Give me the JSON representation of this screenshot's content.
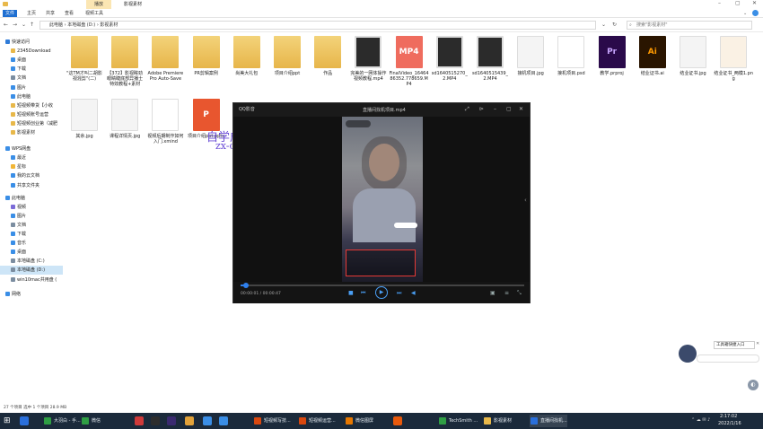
{
  "window": {
    "title": "影视素材",
    "play_tab": "播放"
  },
  "ribbon": {
    "tabs": [
      "文件",
      "主页",
      "共享",
      "查看",
      "视频工具"
    ]
  },
  "address": {
    "path": [
      "此电脑",
      "本地磁盘 (D:)",
      "影视素材"
    ],
    "search_placeholder": "搜索\"影视素材\""
  },
  "nav_pane": {
    "items": [
      {
        "label": "快速访问",
        "icon": "star-icon",
        "color": "#2f7bd8"
      },
      {
        "label": "2345Download",
        "icon": "folder-icon",
        "color": "#e8b84a"
      },
      {
        "label": "桌面",
        "icon": "desktop-icon",
        "color": "#3a8ee6"
      },
      {
        "label": "下载",
        "icon": "download-icon",
        "color": "#3a8ee6"
      },
      {
        "label": "文档",
        "icon": "document-icon",
        "color": "#7b8da0"
      },
      {
        "label": "图片",
        "icon": "picture-icon",
        "color": "#3a8ee6"
      },
      {
        "label": "此电脑",
        "icon": "computer-icon",
        "color": "#3a8ee6"
      },
      {
        "label": "短视频带货【小收",
        "icon": "folder-icon",
        "color": "#e8b84a"
      },
      {
        "label": "短视频账号运营",
        "icon": "folder-icon",
        "color": "#e8b84a"
      },
      {
        "label": "短视频创业第（减肥",
        "icon": "folder-icon",
        "color": "#e8b84a"
      },
      {
        "label": "影视素材",
        "icon": "folder-icon",
        "color": "#e8b84a"
      },
      {
        "label": "WPS网盘",
        "icon": "cloud-icon",
        "color": "#3a8ee6"
      },
      {
        "label": "最近",
        "icon": "clock-icon",
        "color": "#3a8ee6"
      },
      {
        "label": "星标",
        "icon": "star-icon",
        "color": "#f2b636"
      },
      {
        "label": "我的云文档",
        "icon": "cloud-icon",
        "color": "#3a8ee6"
      },
      {
        "label": "共享文件夹",
        "icon": "share-folder-icon",
        "color": "#3a8ee6"
      },
      {
        "label": "此电脑",
        "icon": "computer-icon",
        "color": "#3a8ee6"
      },
      {
        "label": "视频",
        "icon": "video-icon",
        "color": "#7b6bd8"
      },
      {
        "label": "图片",
        "icon": "picture-icon",
        "color": "#3a8ee6"
      },
      {
        "label": "文档",
        "icon": "document-icon",
        "color": "#7b8da0"
      },
      {
        "label": "下载",
        "icon": "download-icon",
        "color": "#3a8ee6"
      },
      {
        "label": "音乐",
        "icon": "music-icon",
        "color": "#3a8ee6"
      },
      {
        "label": "桌面",
        "icon": "desktop-icon",
        "color": "#3a8ee6"
      },
      {
        "label": "本地磁盘 (C:)",
        "icon": "drive-icon",
        "color": "#7b8da0"
      },
      {
        "label": "本地磁盘 (D:)",
        "icon": "drive-icon",
        "color": "#7b8da0"
      },
      {
        "label": "win10mac共用盘 (",
        "icon": "drive-icon",
        "color": "#7b8da0"
      },
      {
        "label": "网络",
        "icon": "network-icon",
        "color": "#3a8ee6"
      }
    ]
  },
  "files": {
    "row1": [
      {
        "name": "\"这TM才叫二胡影视混剪\"(二)",
        "kind": "folder"
      },
      {
        "name": "【372】影视眸劲眼睛睫底部异播士特效教程+素材",
        "kind": "folder"
      },
      {
        "name": "Adobe Premiere Pro Auto-Save",
        "kind": "folder"
      },
      {
        "name": "PR剪辑案例",
        "kind": "folder"
      },
      {
        "name": "尚美大礼包",
        "kind": "folder"
      },
      {
        "name": "项目介绍ppt",
        "kind": "folder"
      },
      {
        "name": "作品",
        "kind": "folder"
      },
      {
        "name": "完美的一网体操作视频教程.mp4",
        "kind": "video"
      },
      {
        "name": "FinalVideo_1646486352.778659.MP4",
        "kind": "mp4"
      },
      {
        "name": "sd1640515270_2.MP4",
        "kind": "video"
      },
      {
        "name": "sd1640515439_2.MP4",
        "kind": "video"
      },
      {
        "name": "接机项目.jpg",
        "kind": "jpg"
      },
      {
        "name": "接机项目.psd",
        "kind": "psd"
      },
      {
        "name": "教学.prproj",
        "kind": "prproj"
      },
      {
        "name": "结业证书.ai",
        "kind": "ai"
      },
      {
        "name": "结业证书.jpg",
        "kind": "jpg"
      },
      {
        "name": "结业证书_两模1.png",
        "kind": "png"
      }
    ],
    "row2": [
      {
        "name": "其余.jpg",
        "kind": "jpg"
      },
      {
        "name": "课程详情页.jpg",
        "kind": "jpg"
      },
      {
        "name": "视频后期制作如何入门.xmind",
        "kind": "xmind"
      },
      {
        "name": "项目介绍ppt.pptx",
        "kind": "pptx"
      }
    ]
  },
  "watermark": {
    "line1": "自学成才网",
    "line2": "zx-cc.net"
  },
  "player": {
    "app_name": "QQ影音",
    "file_title": "直播间找机项目.mp4",
    "time_current": "00:00:01",
    "time_total": "00:00:47",
    "progress": 0.02
  },
  "float_widget": {
    "label": "工具箱快捷入口"
  },
  "status": {
    "text": "27 个项目   选中 1 个项目  28.9 MB"
  },
  "taskbar": {
    "apps": [
      {
        "label": "",
        "color": "#2a6fdb"
      },
      {
        "label": "大羽白 - 手...",
        "color": "#2f9e44"
      },
      {
        "label": "微信",
        "color": "#2f9e44"
      },
      {
        "label": "",
        "color": "#cf3a3a"
      },
      {
        "label": "",
        "color": "#2d2d2d"
      },
      {
        "label": "",
        "color": "#3a2a70"
      },
      {
        "label": "",
        "color": "#e2a23a"
      },
      {
        "label": "",
        "color": "#3a8ee6"
      },
      {
        "label": "",
        "color": "#3a8ee6"
      },
      {
        "label": "短视频写技...",
        "color": "#d9480f"
      },
      {
        "label": "短视频运营...",
        "color": "#d9480f"
      },
      {
        "label": "微信图屏",
        "color": "#e67700"
      },
      {
        "label": "",
        "color": "#e8590c"
      },
      {
        "label": "TechSmith ...",
        "color": "#2f9e44"
      },
      {
        "label": "影视素材",
        "color": "#e8b84a"
      },
      {
        "label": "直播间找机...",
        "color": "#2a6fdb"
      }
    ],
    "clock_time": "2:17:02",
    "clock_date": "2022/1/16"
  }
}
